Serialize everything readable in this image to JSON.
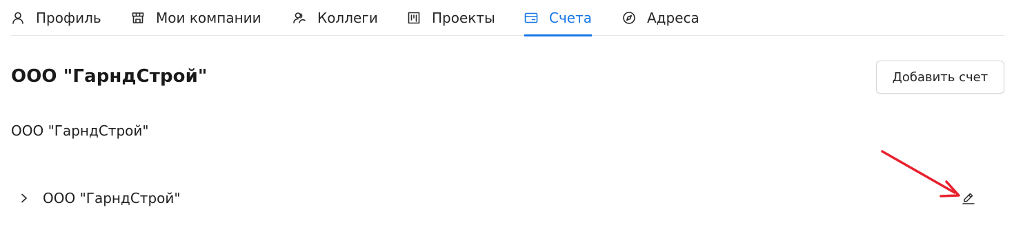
{
  "tabs": [
    {
      "label": "Профиль",
      "icon": "user-icon",
      "active": false
    },
    {
      "label": "Мои компании",
      "icon": "store-icon",
      "active": false
    },
    {
      "label": "Коллеги",
      "icon": "users-icon",
      "active": false
    },
    {
      "label": "Проекты",
      "icon": "kanban-icon",
      "active": false
    },
    {
      "label": "Счета",
      "icon": "credit-card-icon",
      "active": true
    },
    {
      "label": "Адреса",
      "icon": "compass-icon",
      "active": false
    }
  ],
  "header": {
    "title": "ООО \"ГарндСтрой\"",
    "add_button_label": "Добавить счет"
  },
  "company": {
    "name": "ООО \"ГарндСтрой\""
  },
  "accounts": [
    {
      "label": "ООО \"ГарндСтрой\"",
      "expanded": false
    }
  ],
  "colors": {
    "accent": "#1677e6",
    "annotation_arrow": "#e8202e"
  }
}
